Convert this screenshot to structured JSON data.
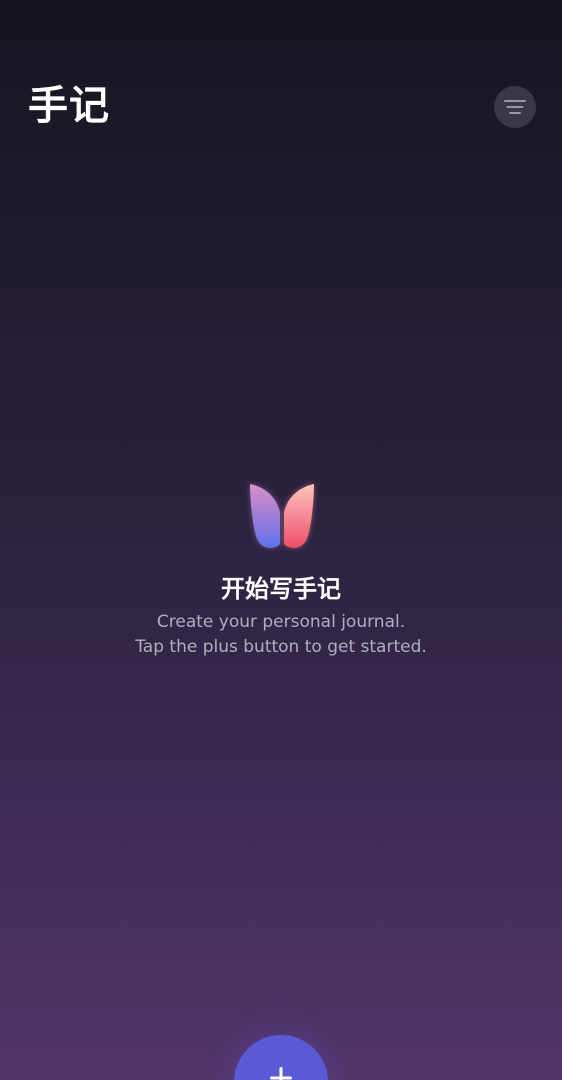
{
  "header": {
    "title": "手记",
    "menu_icon": "menu-lines-icon"
  },
  "empty_state": {
    "logo_icon": "butterfly-logo-icon",
    "title": "开始写手记",
    "subtitle_line1": "Create your personal journal.",
    "subtitle_line2": "Tap the plus button to get started."
  },
  "fab": {
    "icon": "plus-icon",
    "color": "#5a59d6"
  },
  "colors": {
    "background_top": "#17141f",
    "background_bottom": "#54356a",
    "accent": "#5a59d6"
  }
}
